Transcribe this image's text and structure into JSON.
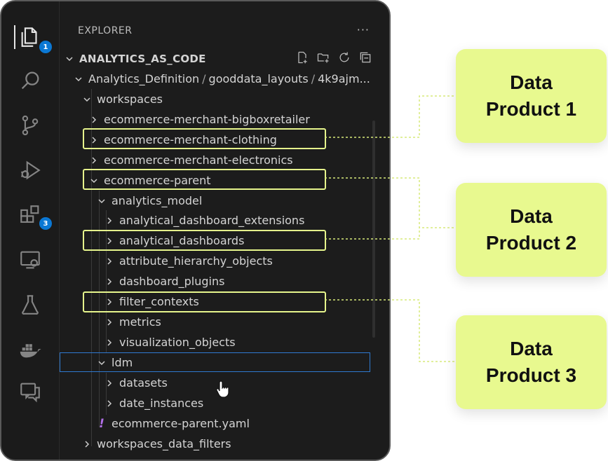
{
  "activity_bar": {
    "items": [
      {
        "name": "explorer-icon",
        "badge": "1",
        "active": true
      },
      {
        "name": "search-icon"
      },
      {
        "name": "source-control-icon"
      },
      {
        "name": "run-debug-icon"
      },
      {
        "name": "extensions-icon",
        "badge": "3"
      },
      {
        "name": "remote-explorer-icon"
      },
      {
        "name": "testing-icon"
      },
      {
        "name": "docker-icon"
      },
      {
        "name": "chat-icon"
      }
    ]
  },
  "sidebar": {
    "header": "EXPLORER",
    "more": "···",
    "root": "ANALYTICS_AS_CODE",
    "breadcrumb": [
      "Analytics_Definition",
      "gooddata_layouts",
      "4k9ajm..."
    ],
    "tree": [
      {
        "label": "workspaces",
        "expanded": true
      },
      {
        "label": "ecommerce-merchant-bigboxretailer",
        "expanded": false
      },
      {
        "label": "ecommerce-merchant-clothing",
        "expanded": false
      },
      {
        "label": "ecommerce-merchant-electronics",
        "expanded": false
      },
      {
        "label": "ecommerce-parent",
        "expanded": true
      },
      {
        "label": "analytics_model",
        "expanded": true
      },
      {
        "label": "analytical_dashboard_extensions",
        "expanded": false
      },
      {
        "label": "analytical_dashboards",
        "expanded": false
      },
      {
        "label": "attribute_hierarchy_objects",
        "expanded": false
      },
      {
        "label": "dashboard_plugins",
        "expanded": false
      },
      {
        "label": "filter_contexts",
        "expanded": false
      },
      {
        "label": "metrics",
        "expanded": false
      },
      {
        "label": "visualization_objects",
        "expanded": false
      },
      {
        "label": "ldm",
        "expanded": true
      },
      {
        "label": "datasets",
        "expanded": false
      },
      {
        "label": "date_instances",
        "expanded": false
      },
      {
        "label": "ecommerce-parent.yaml",
        "file": true
      },
      {
        "label": "workspaces_data_filters",
        "expanded": false
      }
    ]
  },
  "callouts": [
    {
      "line1": "Data",
      "line2": "Product 1"
    },
    {
      "line1": "Data",
      "line2": "Product 2"
    },
    {
      "line1": "Data",
      "line2": "Product 3"
    }
  ],
  "colors": {
    "highlight": "#e6f58c",
    "callout_bg": "#e8f98f",
    "badge": "#0b78d4",
    "yaml_icon": "#b16fe8"
  }
}
